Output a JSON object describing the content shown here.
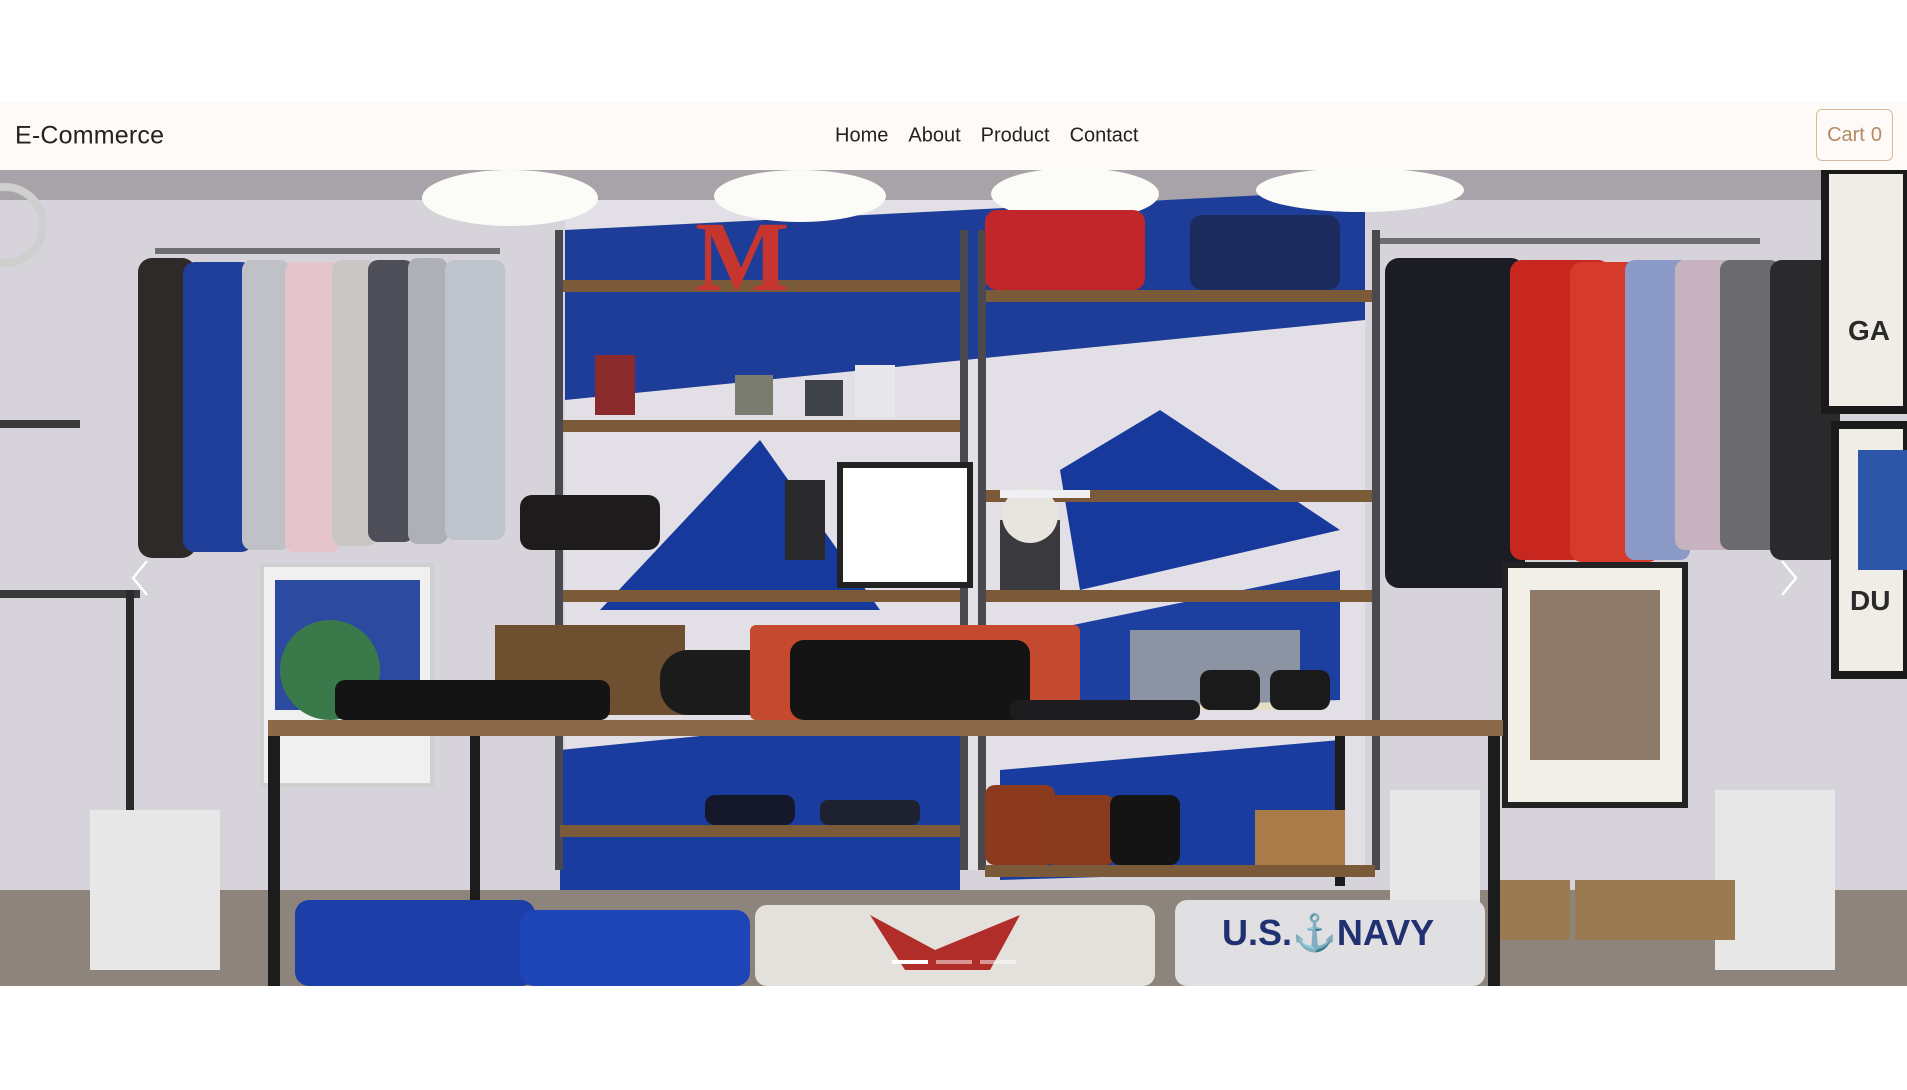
{
  "navbar": {
    "brand": "E-Commerce",
    "links": [
      {
        "label": "Home"
      },
      {
        "label": "About"
      },
      {
        "label": "Product"
      },
      {
        "label": "Contact"
      }
    ],
    "cart": {
      "label": "Cart",
      "count": "0"
    }
  },
  "carousel": {
    "slide_image": "clothing-store-interior-photo",
    "prev_icon": "chevron-left-icon",
    "next_icon": "chevron-right-icon",
    "slide_count": 3,
    "active_index": 0,
    "photo_text": {
      "shelf_letter": "M",
      "blanket_text": "U.S.⚓NAVY",
      "poster_right_top": "GA",
      "poster_right_bottom": "DU"
    }
  }
}
